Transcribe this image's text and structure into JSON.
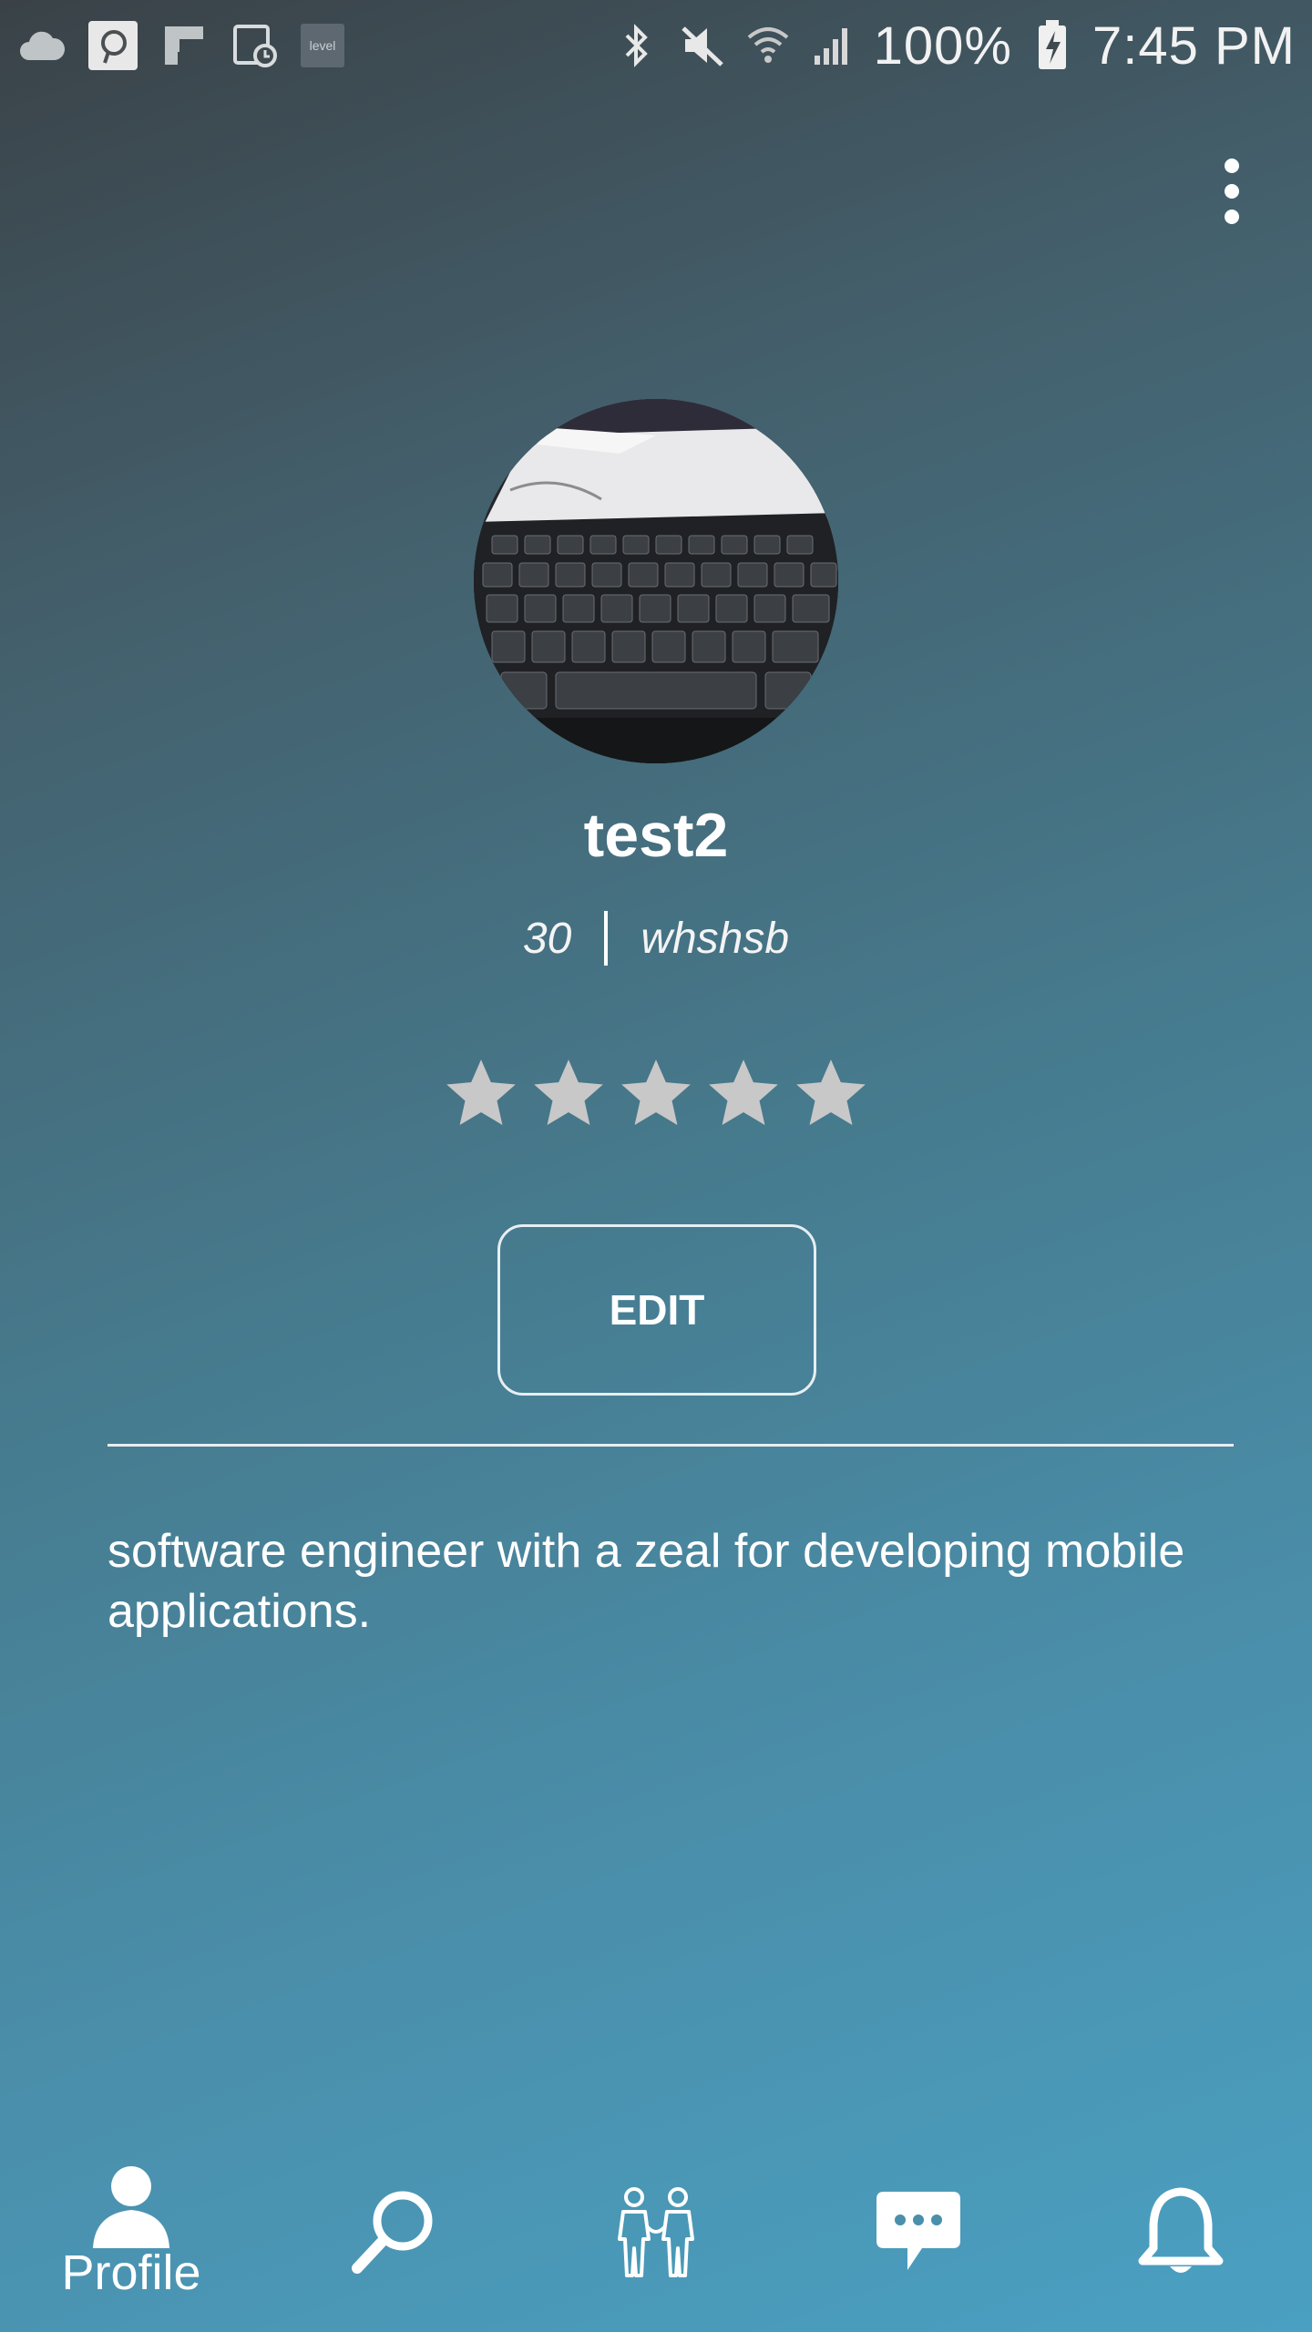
{
  "status_bar": {
    "battery": "100%",
    "time": "7:45 PM",
    "level_app_label": "level",
    "icons": [
      "cloud-icon",
      "pinterest-icon",
      "flipboard-icon",
      "calendar-clock-icon",
      "level-icon",
      "bluetooth-icon",
      "mute-icon",
      "wifi-icon",
      "signal-icon",
      "battery-charging-icon"
    ]
  },
  "profile": {
    "name": "test2",
    "age": "30",
    "location": "whshsb",
    "rating": 0,
    "max_rating": 5,
    "edit_label": "EDIT",
    "bio": "software engineer with a zeal for developing mobile applications."
  },
  "nav": {
    "items": [
      {
        "label": "Profile",
        "icon": "person-icon"
      },
      {
        "label": "",
        "icon": "search-icon"
      },
      {
        "label": "",
        "icon": "people-icon"
      },
      {
        "label": "",
        "icon": "chat-icon"
      },
      {
        "label": "",
        "icon": "bell-icon"
      }
    ]
  },
  "colors": {
    "gradient_top": "#3a4247",
    "gradient_bottom": "#4aa0c2",
    "star_empty": "#c8c8c8"
  }
}
